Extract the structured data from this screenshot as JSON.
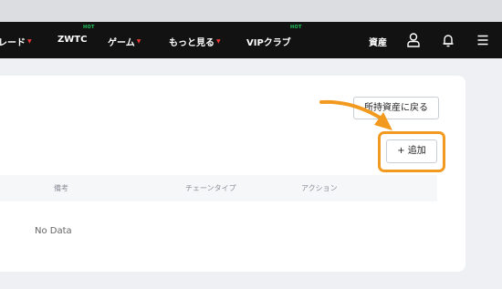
{
  "nav": {
    "trade_tail": "レード",
    "zwtc": "ZWTC",
    "zwtc_badge": "HOT",
    "game": "ゲーム",
    "more": "もっと見る",
    "vip": "VIPクラブ",
    "vip_badge": "HOT",
    "assets": "資産",
    "icons": [
      "user-icon",
      "bell-icon",
      "menu-icon"
    ]
  },
  "actions": {
    "back_to_holdings": "所持資産に戻る",
    "add": "+ 追加"
  },
  "table": {
    "columns": [
      "備考",
      "チェーンタイプ",
      "アクション"
    ],
    "empty_text": "No Data"
  },
  "colors": {
    "navbar_bg": "#121212",
    "highlight": "#f29a1f",
    "hot_badge": "#22c55e",
    "dropdown_dot": "#e53935"
  }
}
